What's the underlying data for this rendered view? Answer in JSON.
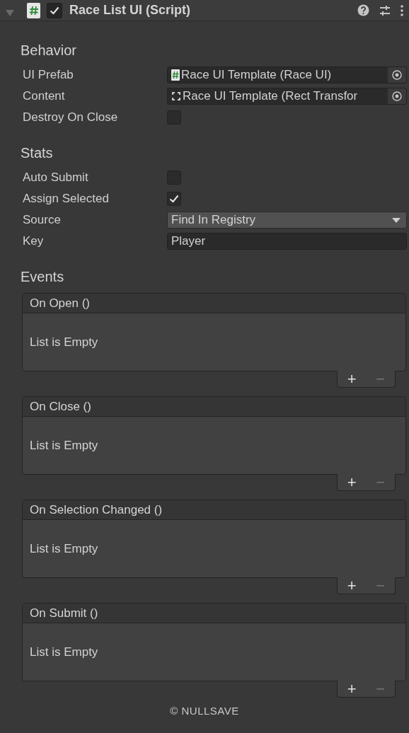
{
  "component": {
    "title": "Race List UI (Script)",
    "expanded": true,
    "enabled": true
  },
  "sections": [
    {
      "heading": "Behavior",
      "properties": [
        {
          "label": "UI Prefab",
          "kind": "script-object",
          "value": "Race UI Template (Race UI)"
        },
        {
          "label": "Content",
          "kind": "transform-object",
          "value": "Race UI Template (Rect Transfor"
        },
        {
          "label": "Destroy On Close",
          "kind": "toggle",
          "checked": false
        }
      ]
    },
    {
      "heading": "Stats",
      "properties": [
        {
          "label": "Auto Submit",
          "kind": "toggle",
          "checked": false
        },
        {
          "label": "Assign Selected",
          "kind": "toggle",
          "checked": true
        },
        {
          "label": "Source",
          "kind": "dropdown",
          "value": "Find In Registry"
        },
        {
          "label": "Key",
          "kind": "text",
          "value": "Player"
        }
      ]
    }
  ],
  "events_heading": "Events",
  "events": [
    {
      "title": "On Open ()",
      "empty_text": "List is Empty",
      "add": "+",
      "remove": "−",
      "remove_disabled": true
    },
    {
      "title": "On Close ()",
      "empty_text": "List is Empty",
      "add": "+",
      "remove": "−",
      "remove_disabled": true
    },
    {
      "title": "On Selection Changed ()",
      "empty_text": "List is Empty",
      "add": "+",
      "remove": "−",
      "remove_disabled": true
    },
    {
      "title": "On Submit ()",
      "empty_text": "List is Empty",
      "add": "+",
      "remove": "−",
      "remove_disabled": true
    }
  ],
  "footer": "© NULLSAVE"
}
